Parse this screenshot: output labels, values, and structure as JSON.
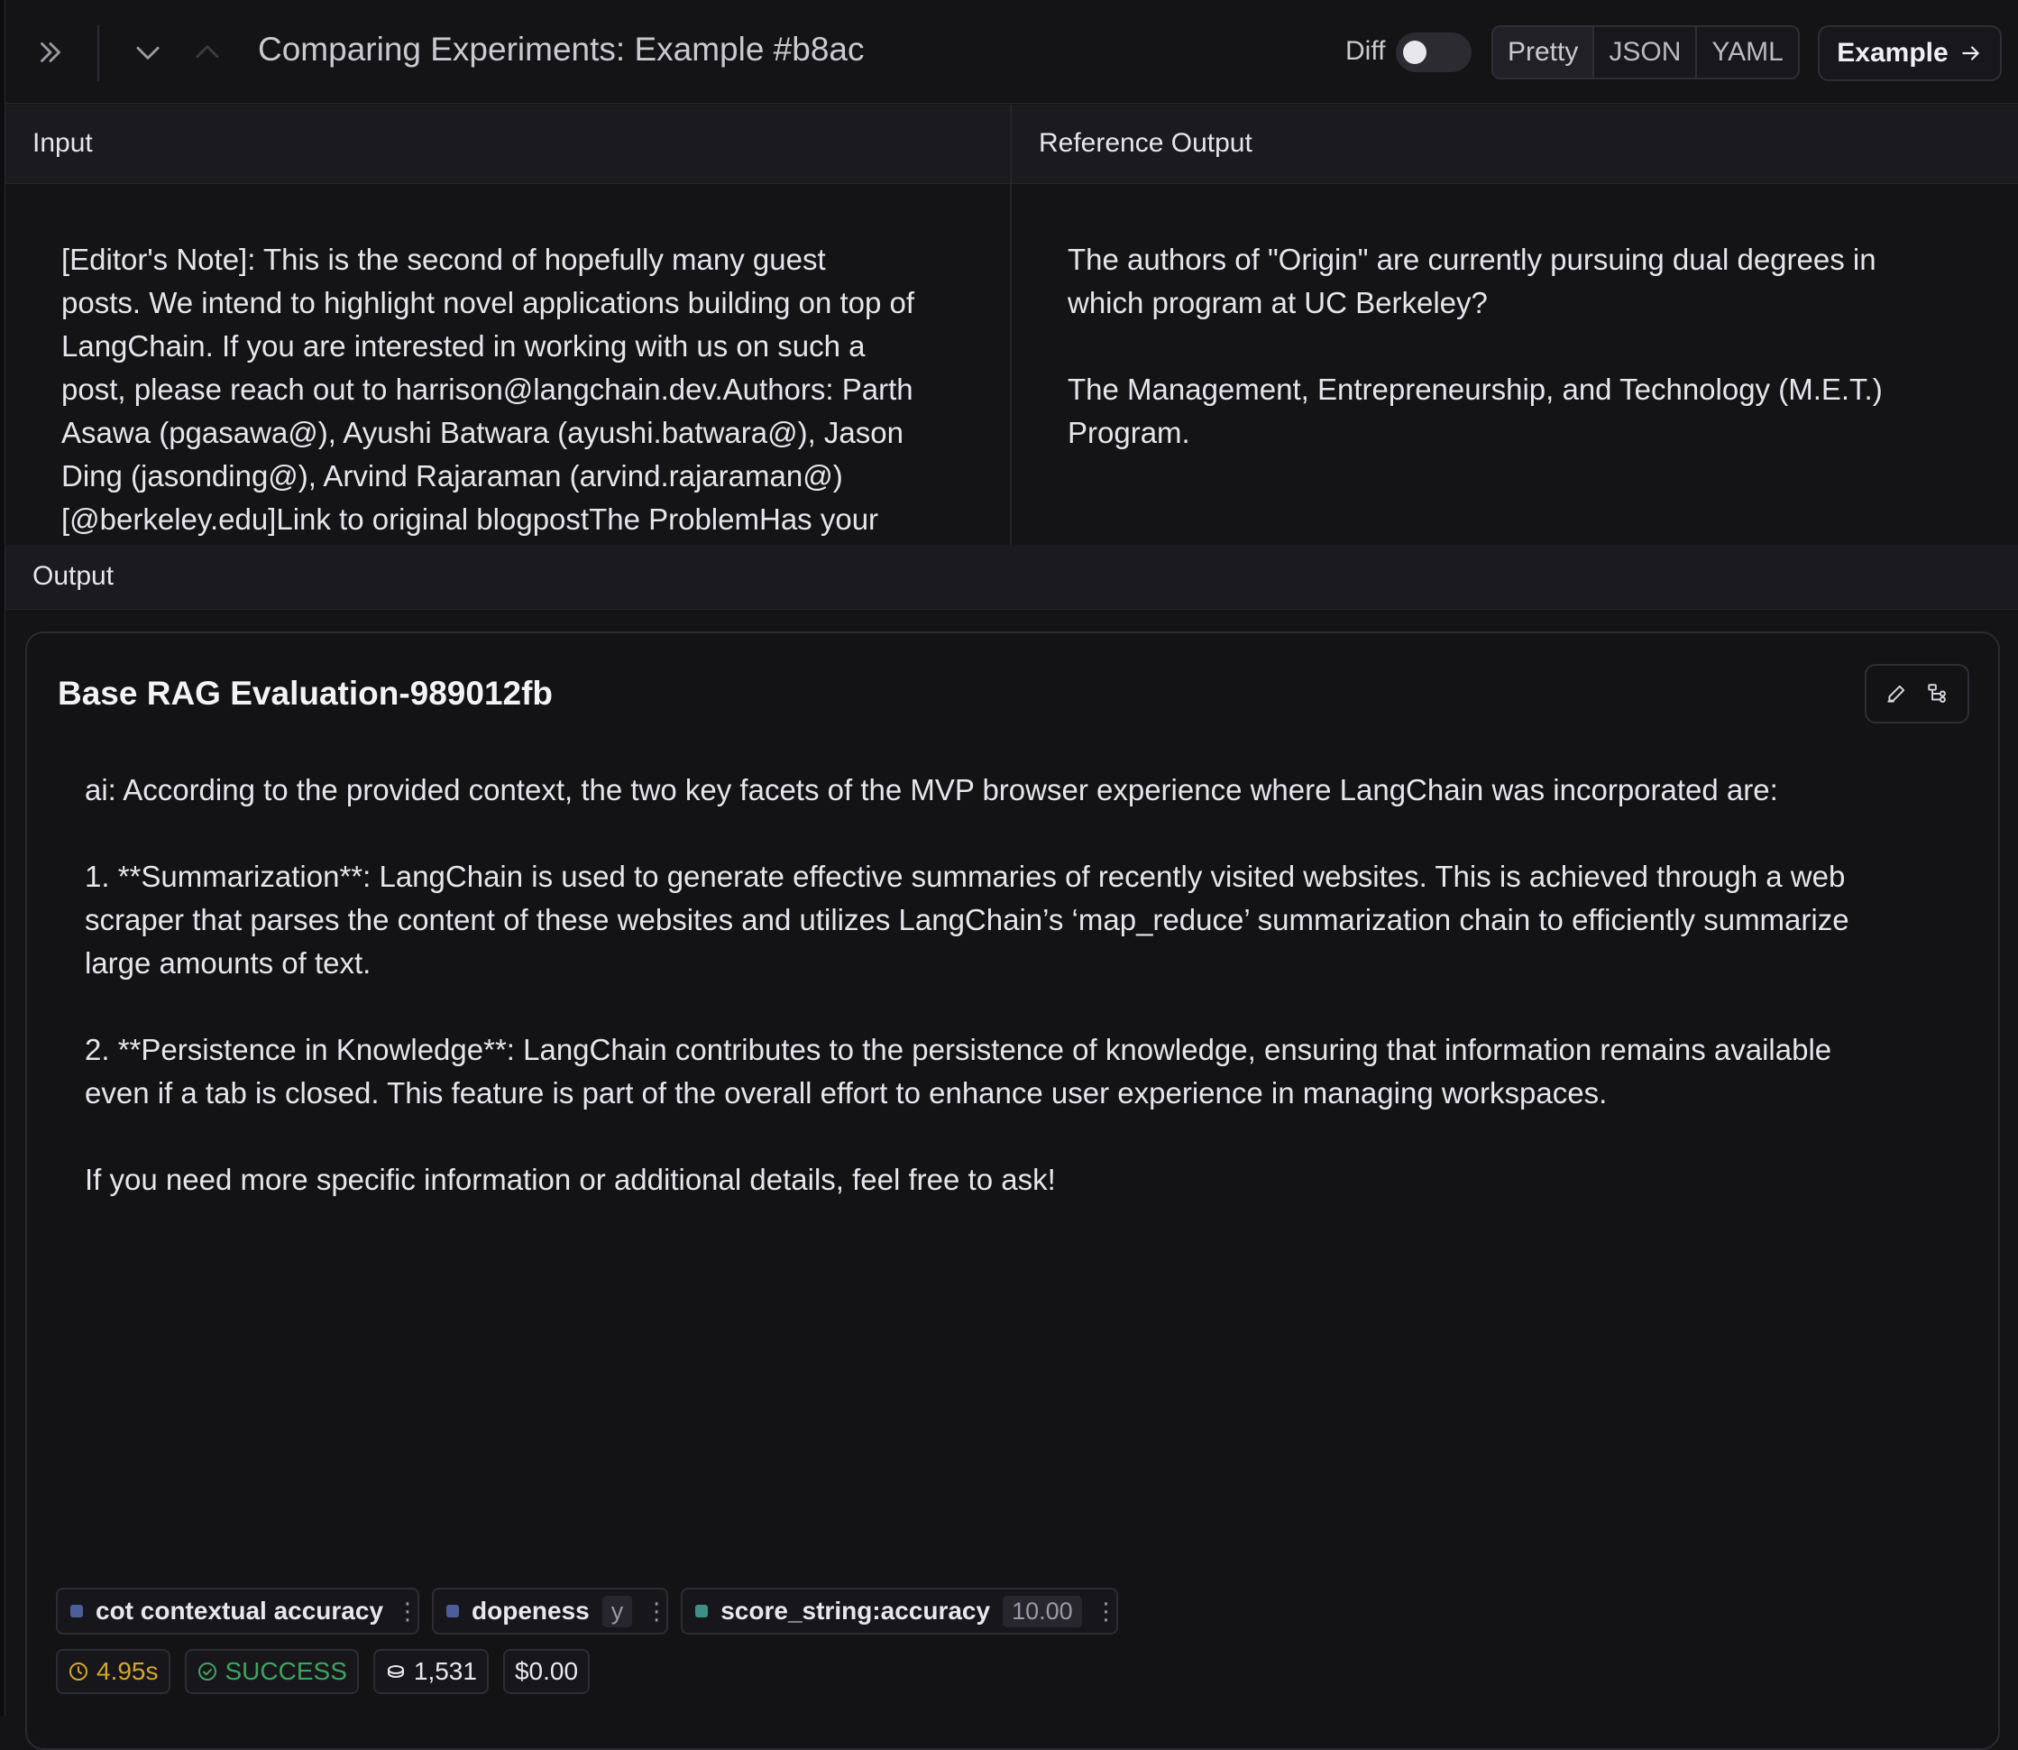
{
  "header": {
    "title": "Comparing Experiments: Example #b8ac",
    "diff_label": "Diff",
    "diff_enabled": false,
    "view_modes": [
      "Pretty",
      "JSON",
      "YAML"
    ],
    "active_view_mode": "Pretty",
    "example_button": "Example",
    "icons": [
      "double-chevron-right-icon",
      "chevron-down-icon",
      "chevron-up-icon",
      "arrow-right-icon"
    ]
  },
  "input": {
    "label": "Input",
    "text": "[Editor's Note]: This is the second of hopefully many guest\nposts. We intend to highlight novel applications building on top of\nLangChain. If you are interested in working with us on such a\npost, please reach out to harrison@langchain.dev.Authors: Parth\nAsawa (pgasawa@), Ayushi Batwara (ayushi.batwara@), Jason\nDing (jasonding@), Arvind Rajaraman (arvind.rajaraman@)\n[@berkeley.edu]Link to original blogpostThe ProblemHas your"
  },
  "reference": {
    "label": "Reference Output",
    "text": "The authors of \"Origin\" are currently pursuing dual degrees in\nwhich program at UC Berkeley?\n\nThe Management, Entrepreneurship, and Technology (M.E.T.)\nProgram."
  },
  "output": {
    "label": "Output",
    "run_title": "Base RAG Evaluation-989012fb",
    "text": "ai: According to the provided context, the two key facets of the MVP browser experience where LangChain was incorporated are:\n\n1. **Summarization**: LangChain is used to generate effective summaries of recently visited websites. This is achieved through a web\nscraper that parses the content of these websites and utilizes LangChain’s ‘map_reduce’ summarization chain to efficiently summarize\nlarge amounts of text.\n\n2. **Persistence in Knowledge**: LangChain contributes to the persistence of knowledge, ensuring that information remains available\neven if a tab is closed. This feature is part of the overall effort to enhance user experience in managing workspaces.\n\nIf you need more specific information or additional details, feel free to ask!",
    "feedback": [
      {
        "name": "cot contextual accuracy",
        "value": "",
        "color": "#4b5e9a"
      },
      {
        "name": "dopeness",
        "value": "y",
        "color": "#4b5e9a"
      },
      {
        "name": "score_string:accuracy",
        "value": "10.00",
        "color": "#3e8f86"
      }
    ],
    "metrics": {
      "latency": "4.95s",
      "status": "SUCCESS",
      "tokens": "1,531",
      "cost": "$0.00"
    }
  },
  "colors": {
    "background": "#141417",
    "panel_header": "#1b1b1f",
    "latency": "#d5a42e",
    "success": "#3fa35f"
  }
}
